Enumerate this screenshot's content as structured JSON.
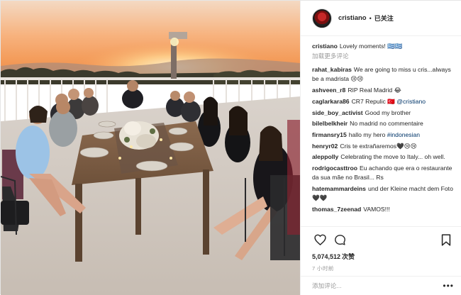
{
  "colors": {
    "accent_link": "#003569",
    "muted": "#999999",
    "border": "#efefef"
  },
  "header": {
    "username": "cristiano",
    "separator": "•",
    "follow_status": "已关注"
  },
  "caption": {
    "username": "cristiano",
    "text": "Lovely moments! ",
    "emoji": "🇬🇷🇬🇷"
  },
  "load_more_label": "加载更多评论",
  "comments": [
    {
      "user": "rahat_kabiras",
      "text": "We are going to miss u cris...always be a madrista 😢😢"
    },
    {
      "user": "ashveen_r8",
      "text": "RIP Real Madrid 😂"
    },
    {
      "user": "caglarkara86",
      "text": "CR7 Repulic 🇹🇷 ",
      "tag": "@cristiano"
    },
    {
      "user": "side_boy_activist",
      "text": "Good my brother"
    },
    {
      "user": "bilelbelkheir",
      "text": "No madrid no commentaire"
    },
    {
      "user": "firmansry15",
      "text": "hallo my hero ",
      "tag": "#indonesian"
    },
    {
      "user": "henryr02",
      "text": "Cris te extrañaremos🖤😢😢"
    },
    {
      "user": "aleppolly",
      "text": "Celebrating the move to Italy... oh well."
    },
    {
      "user": "rodrigocasttroo",
      "text": "Eu achando que era o restaurante da sua mãe no Brasil... Rs"
    },
    {
      "user": "hatemammardeins",
      "text": "und der Kleine macht dem Foto🖤🖤"
    },
    {
      "user": "thomas_7zeenad",
      "text": "VAMOS!!!"
    }
  ],
  "actions": {
    "like_icon": "heart-outline-icon",
    "comment_icon": "speech-bubble-icon",
    "save_icon": "bookmark-icon"
  },
  "likes": {
    "count": "5,074,512",
    "label": "次赞"
  },
  "time_ago": "7 小时前",
  "add_comment": {
    "placeholder": "添加评论...",
    "more_label": "•••"
  }
}
